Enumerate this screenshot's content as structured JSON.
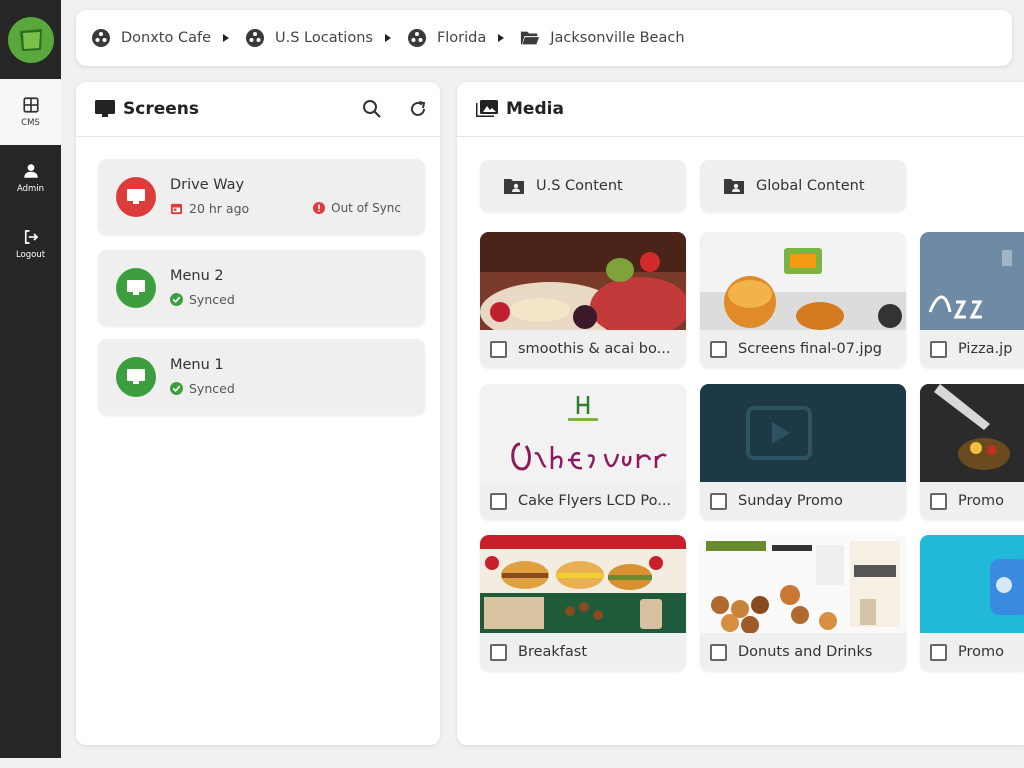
{
  "sidebar": {
    "items": [
      {
        "label": "CMS",
        "icon": "grid-icon"
      },
      {
        "label": "Admin",
        "icon": "user-icon"
      },
      {
        "label": "Logout",
        "icon": "logout-icon"
      }
    ]
  },
  "breadcrumb": [
    {
      "label": "Donxto Cafe",
      "icon": "location-icon"
    },
    {
      "label": "U.S Locations",
      "icon": "location-icon"
    },
    {
      "label": "Florida",
      "icon": "location-icon"
    },
    {
      "label": "Jacksonville Beach",
      "icon": "folder-open-icon"
    }
  ],
  "screens": {
    "title": "Screens",
    "items": [
      {
        "name": "Drive Way",
        "sub": "20 hr ago",
        "status": "Out of Sync",
        "state": "error"
      },
      {
        "name": "Menu 2",
        "sub": "Synced",
        "state": "ok"
      },
      {
        "name": "Menu 1",
        "sub": "Synced",
        "state": "ok"
      }
    ]
  },
  "media": {
    "title": "Media",
    "folders": [
      {
        "label": "U.S Content"
      },
      {
        "label": "Global Content"
      }
    ],
    "tiles": [
      {
        "name": "smoothis & acai bo..."
      },
      {
        "name": "Screens final-07.jpg"
      },
      {
        "name": "Pizza.jp"
      },
      {
        "name": "Cake Flyers LCD Po..."
      },
      {
        "name": "Sunday Promo"
      },
      {
        "name": "Promo"
      },
      {
        "name": "Breakfast"
      },
      {
        "name": "Donuts and Drinks"
      },
      {
        "name": "Promo"
      }
    ]
  },
  "colors": {
    "sidebar": "#262626",
    "accent_green": "#3d9e40",
    "error_red": "#de3b3b",
    "logo_green": "#5aa83c"
  }
}
